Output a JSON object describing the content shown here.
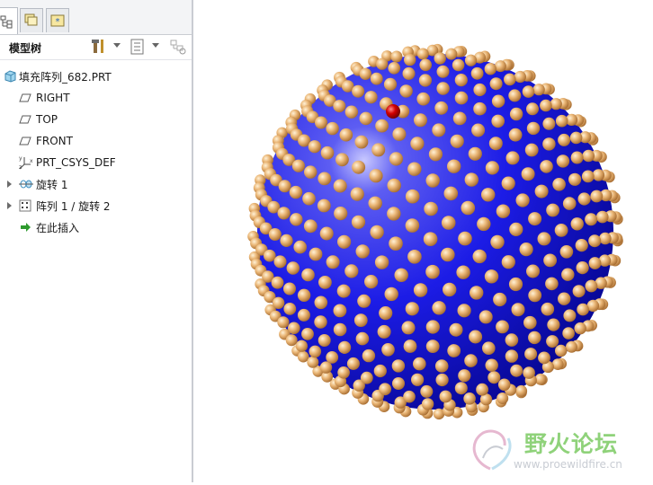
{
  "panel": {
    "tabs": [
      "model-tree-tab",
      "layers-tab",
      "favorites-tab"
    ],
    "toolbar": {
      "title": "模型树",
      "settings_icon": "tools-icon",
      "show_icon": "list-settings-icon",
      "filter_icon": "tree-filter-icon"
    },
    "tree": [
      {
        "label": "填充阵列_682.PRT",
        "icon": "part-icon",
        "expandable": false
      },
      {
        "label": "RIGHT",
        "icon": "datum-plane-icon",
        "expandable": false
      },
      {
        "label": "TOP",
        "icon": "datum-plane-icon",
        "expandable": false
      },
      {
        "label": "FRONT",
        "icon": "datum-plane-icon",
        "expandable": false
      },
      {
        "label": "PRT_CSYS_DEF",
        "icon": "csys-icon",
        "expandable": false
      },
      {
        "label": "旋转 1",
        "icon": "revolve-icon",
        "expandable": true
      },
      {
        "label": "阵列 1 / 旋转 2",
        "icon": "pattern-icon",
        "expandable": true
      },
      {
        "label": "在此插入",
        "icon": "insert-here-arrow-icon",
        "expandable": false
      }
    ]
  },
  "viewport": {
    "model": "sphere with patterned beads",
    "colors": {
      "sphere": "#1a1ae0",
      "beads": "#e8b06a",
      "highlight": "#cc0000"
    }
  },
  "watermark": {
    "text": "野火论坛",
    "url": "www.proewildfire.cn"
  }
}
